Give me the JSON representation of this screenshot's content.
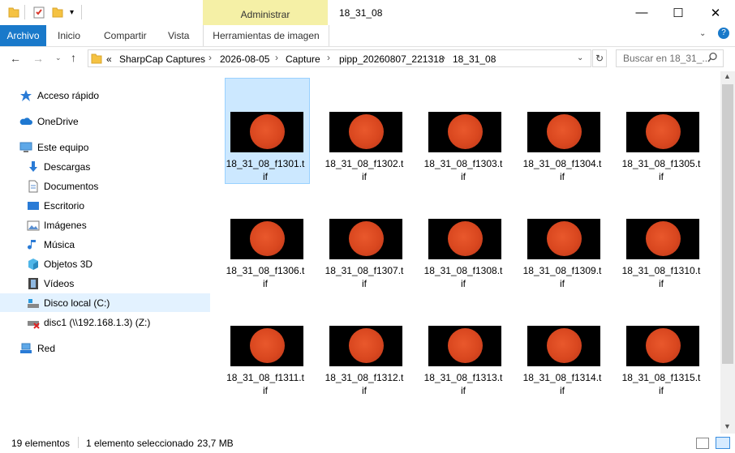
{
  "window": {
    "title": "18_31_08",
    "contextual_tab_group": "Administrar",
    "controls": {
      "minimize": "—",
      "maximize": "☐",
      "close": "✕"
    }
  },
  "ribbon": {
    "tabs": [
      "Archivo",
      "Inicio",
      "Compartir",
      "Vista",
      "Herramientas de imagen"
    ]
  },
  "address": {
    "overflow": "«",
    "crumbs": [
      "SharpCap Captures",
      "2026-08-05",
      "Capture",
      "pipp_20260807_221318",
      "18_31_08"
    ],
    "search_placeholder": "Buscar en 18_31_..."
  },
  "sidebar": {
    "items": [
      {
        "label": "Acceso rápido",
        "icon": "star-icon"
      },
      {
        "label": "OneDrive",
        "icon": "cloud-icon"
      },
      {
        "label": "Este equipo",
        "icon": "computer-icon"
      },
      {
        "label": "Descargas",
        "icon": "download-icon"
      },
      {
        "label": "Documentos",
        "icon": "document-icon"
      },
      {
        "label": "Escritorio",
        "icon": "desktop-icon"
      },
      {
        "label": "Imágenes",
        "icon": "pictures-icon"
      },
      {
        "label": "Música",
        "icon": "music-icon"
      },
      {
        "label": "Objetos 3D",
        "icon": "cube-icon"
      },
      {
        "label": "Vídeos",
        "icon": "video-icon"
      },
      {
        "label": "Disco local (C:)",
        "icon": "drive-icon"
      },
      {
        "label": "disc1 (\\\\192.168.1.3) (Z:)",
        "icon": "network-drive-icon"
      },
      {
        "label": "Red",
        "icon": "network-icon"
      }
    ]
  },
  "files": [
    "18_31_08_f1301.tif",
    "18_31_08_f1302.tif",
    "18_31_08_f1303.tif",
    "18_31_08_f1304.tif",
    "18_31_08_f1305.tif",
    "18_31_08_f1306.tif",
    "18_31_08_f1307.tif",
    "18_31_08_f1308.tif",
    "18_31_08_f1309.tif",
    "18_31_08_f1310.tif",
    "18_31_08_f1311.tif",
    "18_31_08_f1312.tif",
    "18_31_08_f1313.tif",
    "18_31_08_f1314.tif",
    "18_31_08_f1315.tif"
  ],
  "status": {
    "count": "19 elementos",
    "selection": "1 elemento seleccionado",
    "size": "23,7 MB"
  }
}
